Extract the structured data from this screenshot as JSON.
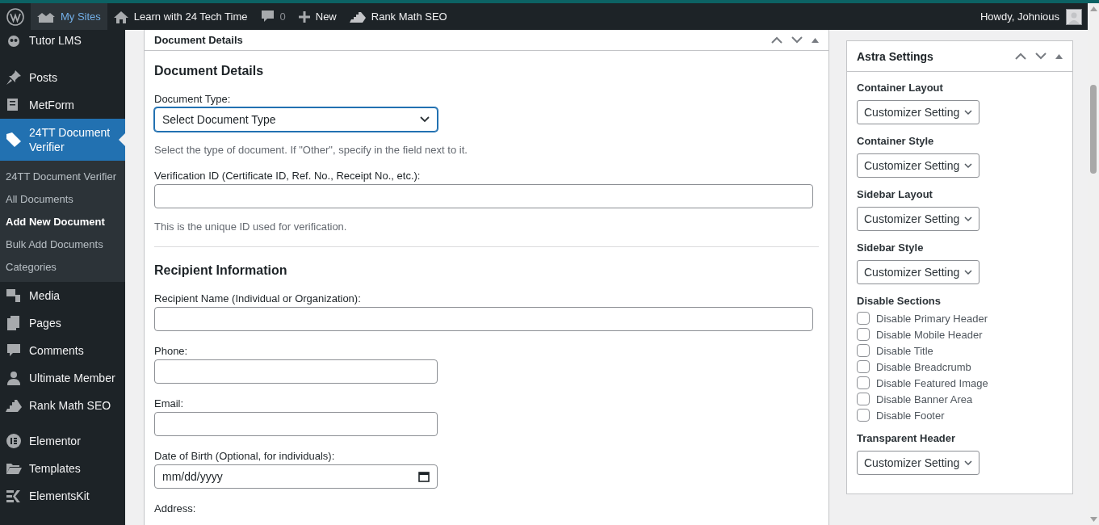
{
  "admin_bar": {
    "items": [
      {
        "kind": "logo"
      },
      {
        "kind": "sites",
        "label": "My Sites",
        "selected": true
      },
      {
        "kind": "home",
        "label": "Learn with 24 Tech Time",
        "selected": false
      },
      {
        "kind": "comments",
        "label": "0",
        "selected": false
      },
      {
        "kind": "new",
        "label": "New",
        "selected": false
      },
      {
        "kind": "rank",
        "label": "Rank Math SEO",
        "selected": false
      }
    ],
    "greeting": "Howdy, Johnious"
  },
  "sidebar": {
    "items": [
      {
        "label": "Tutor LMS",
        "selected": false
      },
      {
        "label": "Posts",
        "selected": false
      },
      {
        "label": "MetForm",
        "selected": false
      },
      {
        "label": "24TT Document Verifier",
        "selected": true,
        "children": [
          {
            "label": "24TT Document Verifier",
            "selected": false
          },
          {
            "label": "All Documents",
            "selected": false
          },
          {
            "label": "Add New Document",
            "selected": true
          },
          {
            "label": "Bulk Add Documents",
            "selected": false
          },
          {
            "label": "Categories",
            "selected": false
          }
        ]
      },
      {
        "label": "Media",
        "selected": false
      },
      {
        "label": "Pages",
        "selected": false
      },
      {
        "label": "Comments",
        "selected": false
      },
      {
        "label": "Ultimate Member",
        "selected": false
      },
      {
        "label": "Rank Math SEO",
        "selected": false
      },
      {
        "label": "Elementor",
        "selected": false
      },
      {
        "label": "Templates",
        "selected": false
      },
      {
        "label": "ElementsKit",
        "selected": false
      }
    ]
  },
  "document_box": {
    "title": "Document Details",
    "sections": [
      {
        "heading": "Document Details",
        "fields": [
          {
            "kind": "select",
            "label": "Document Type:",
            "value": "Select Document Type",
            "focused": true,
            "help": "Select the type of document. If \"Other\", specify in the field next to it."
          },
          {
            "kind": "text",
            "label": "Verification ID (Certificate ID, Ref. No., Receipt No., etc.):",
            "help": "This is the unique ID used for verification."
          }
        ]
      },
      {
        "heading": "Recipient Information",
        "fields": [
          {
            "kind": "text",
            "label": "Recipient Name (Individual or Organization):"
          },
          {
            "kind": "text",
            "label": "Phone:"
          },
          {
            "kind": "text",
            "label": "Email:"
          },
          {
            "kind": "date",
            "label": "Date of Birth (Optional, for individuals):",
            "placeholder": "mm/dd/yyyy"
          },
          {
            "kind": "label",
            "label": "Address:"
          }
        ]
      }
    ]
  },
  "astra_settings": {
    "title": "Astra Settings",
    "groups": [
      {
        "kind": "select",
        "label": "Container Layout",
        "value": "Customizer Setting"
      },
      {
        "kind": "select",
        "label": "Container Style",
        "value": "Customizer Setting"
      },
      {
        "kind": "select",
        "label": "Sidebar Layout",
        "value": "Customizer Setting"
      },
      {
        "kind": "select",
        "label": "Sidebar Style",
        "value": "Customizer Setting"
      },
      {
        "kind": "checkboxes",
        "label": "Disable Sections",
        "options": [
          {
            "label": "Disable Primary Header",
            "checked": false
          },
          {
            "label": "Disable Mobile Header",
            "checked": false
          },
          {
            "label": "Disable Title",
            "checked": false
          },
          {
            "label": "Disable Breadcrumb",
            "checked": false
          },
          {
            "label": "Disable Featured Image",
            "checked": false
          },
          {
            "label": "Disable Banner Area",
            "checked": false
          },
          {
            "label": "Disable Footer",
            "checked": false
          }
        ]
      },
      {
        "kind": "select",
        "label": "Transparent Header",
        "value": "Customizer Setting"
      }
    ]
  }
}
